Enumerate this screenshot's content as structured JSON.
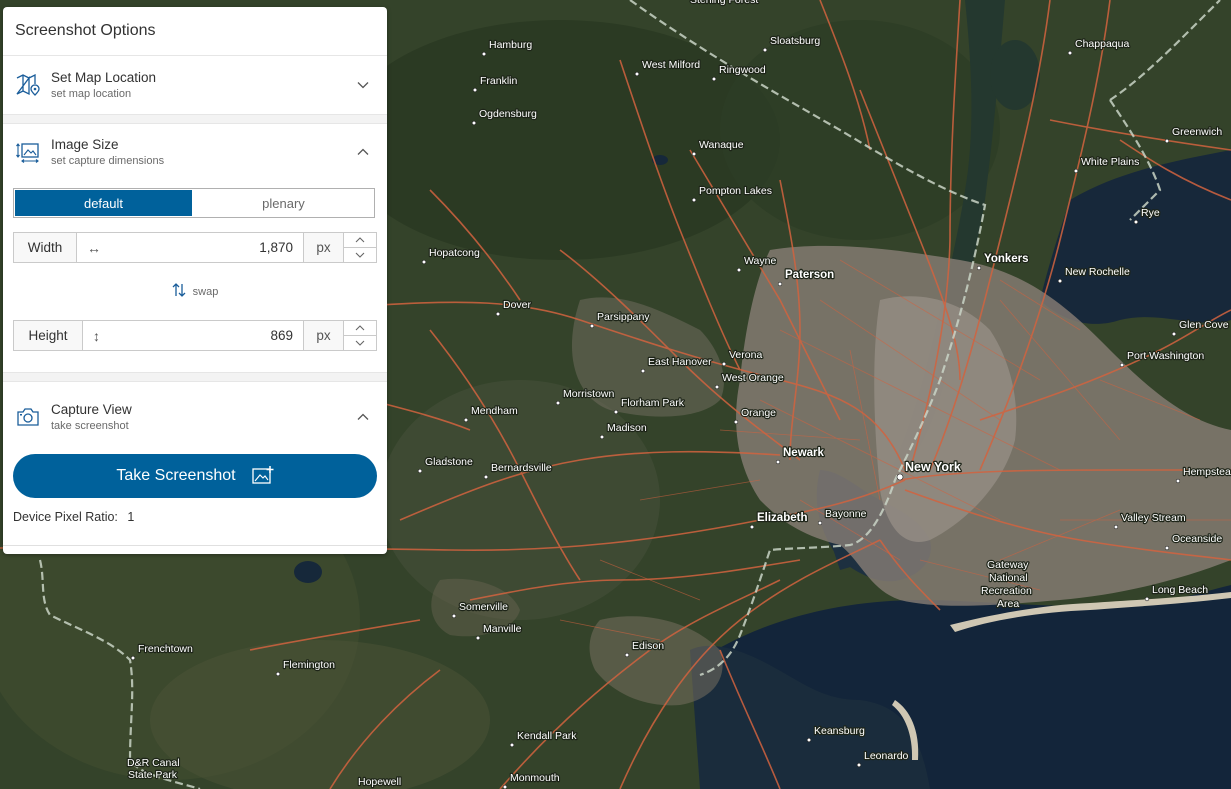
{
  "panel": {
    "title": "Screenshot Options",
    "set_map_location": {
      "title": "Set Map Location",
      "subtitle": "set map location"
    },
    "image_size": {
      "title": "Image Size",
      "subtitle": "set capture dimensions",
      "modes": [
        "default",
        "plenary"
      ],
      "selected_mode": "default",
      "width_label": "Width",
      "width_value": "1,870",
      "height_label": "Height",
      "height_value": "869",
      "unit": "px",
      "swap_label": "swap"
    },
    "capture_view": {
      "title": "Capture View",
      "subtitle": "take screenshot",
      "button_label": "Take Screenshot",
      "dpr_label": "Device Pixel Ratio:",
      "dpr_value": "1"
    }
  },
  "map": {
    "labels": [
      "Sterling Forest",
      "Hamburg",
      "Sloatsburg",
      "Chappaqua",
      "West Milford",
      "Ringwood",
      "Franklin",
      "Ogdensburg",
      "Greenwich",
      "Wanaque",
      "White Plains",
      "Pompton Lakes",
      "Rye",
      "Hopatcong",
      "Wayne",
      "Paterson",
      "Yonkers",
      "New Rochelle",
      "Dover",
      "Parsippany",
      "Glen Cove",
      "Port Washington",
      "East Hanover",
      "Verona",
      "West Orange",
      "Morristown",
      "Florham Park",
      "Mendham",
      "Orange",
      "Madison",
      "Newark",
      "New York",
      "Gladstone",
      "Bernardsville",
      "Hempstead",
      "Elizabeth",
      "Bayonne",
      "Valley Stream",
      "Oceanside",
      "Gateway",
      "National",
      "Recreation",
      "Area",
      "Long Beach",
      "Somerville",
      "Manville",
      "Frenchtown",
      "Flemington",
      "Edison",
      "Kendall Park",
      "Keansburg",
      "Leonardo",
      "D&R Canal",
      "State Park",
      "Monmouth",
      "Hopewell"
    ],
    "colors": {
      "land": "#34432a",
      "water": "#13253a",
      "urban": "#8b8077",
      "roads": "#d2633f",
      "boundary": "#c9d4c6"
    }
  }
}
